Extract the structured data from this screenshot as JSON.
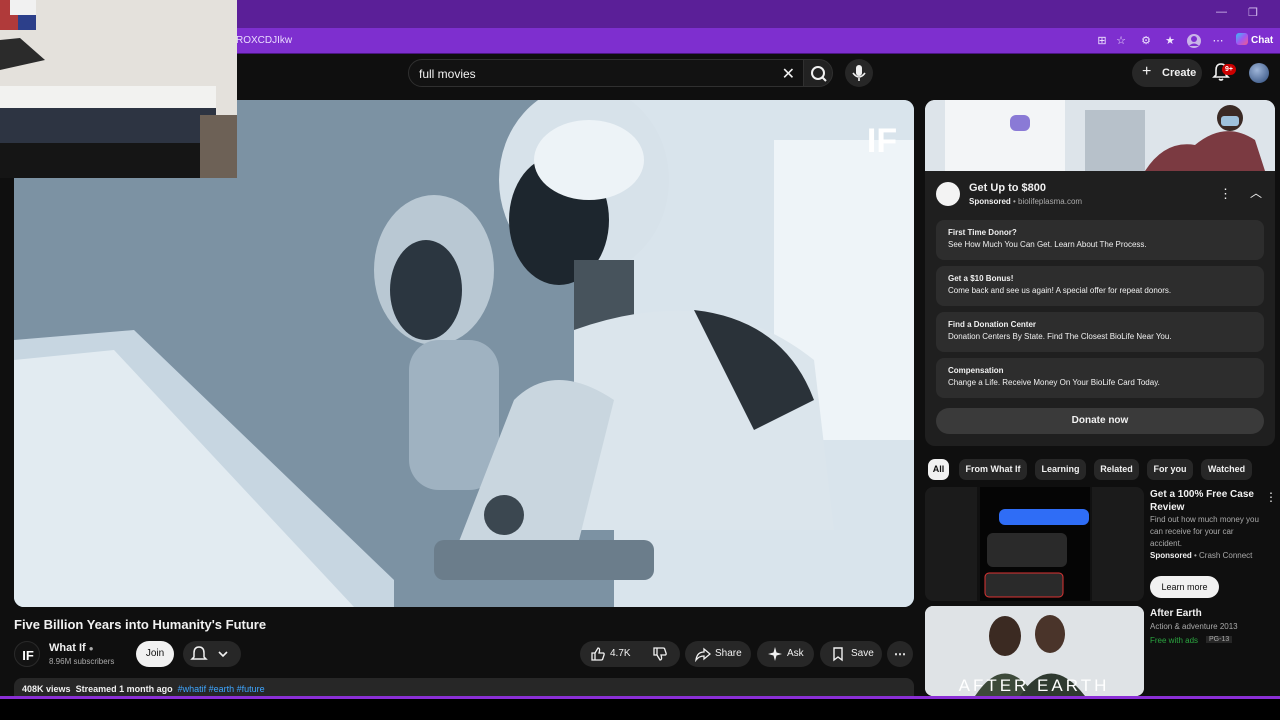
{
  "browser": {
    "url_fragment": "ROXCDJIkw",
    "chat_label": "Chat"
  },
  "masthead": {
    "search_value": "full movies",
    "create_label": "Create",
    "notification_count": "9+"
  },
  "video": {
    "title": "Five Billion Years into Humanity's Future",
    "channel_name": "What If",
    "subscribers": "8.96M subscribers",
    "join_label": "Join",
    "likes": "4.7K",
    "share_label": "Share",
    "ask_label": "Ask",
    "save_label": "Save",
    "views": "408K views",
    "streamed": "Streamed 1 month ago",
    "hashtags": "#whatif #earth #future",
    "watermark": "IF"
  },
  "ad": {
    "title": "Get Up to $800",
    "sponsored": "Sponsored",
    "domain": "biolifeplasma.com",
    "links": [
      {
        "title": "First Time Donor?",
        "desc": "See How Much You Can Get. Learn About The Process."
      },
      {
        "title": "Get a $10 Bonus!",
        "desc": "Come back and see us again! A special offer for repeat donors."
      },
      {
        "title": "Find a Donation Center",
        "desc": "Donation Centers By State. Find The Closest BioLife Near You."
      },
      {
        "title": "Compensation",
        "desc": "Change a Life. Receive Money On Your BioLife Card Today."
      }
    ],
    "cta": "Donate now"
  },
  "chips": [
    "All",
    "From What If",
    "Learning",
    "Related",
    "For you",
    "Watched"
  ],
  "recommendations": [
    {
      "title": "Get a 100% Free Case Review",
      "desc": "Find out how much money you can receive for your car accident.",
      "sponsored": "Sponsored",
      "advertiser": "Crash Connect",
      "cta": "Learn more"
    },
    {
      "title": "After Earth",
      "meta": "Action & adventure 2013",
      "free": "Free with ads",
      "rating": "PG-13",
      "thumb_text": "AFTER EARTH"
    }
  ]
}
